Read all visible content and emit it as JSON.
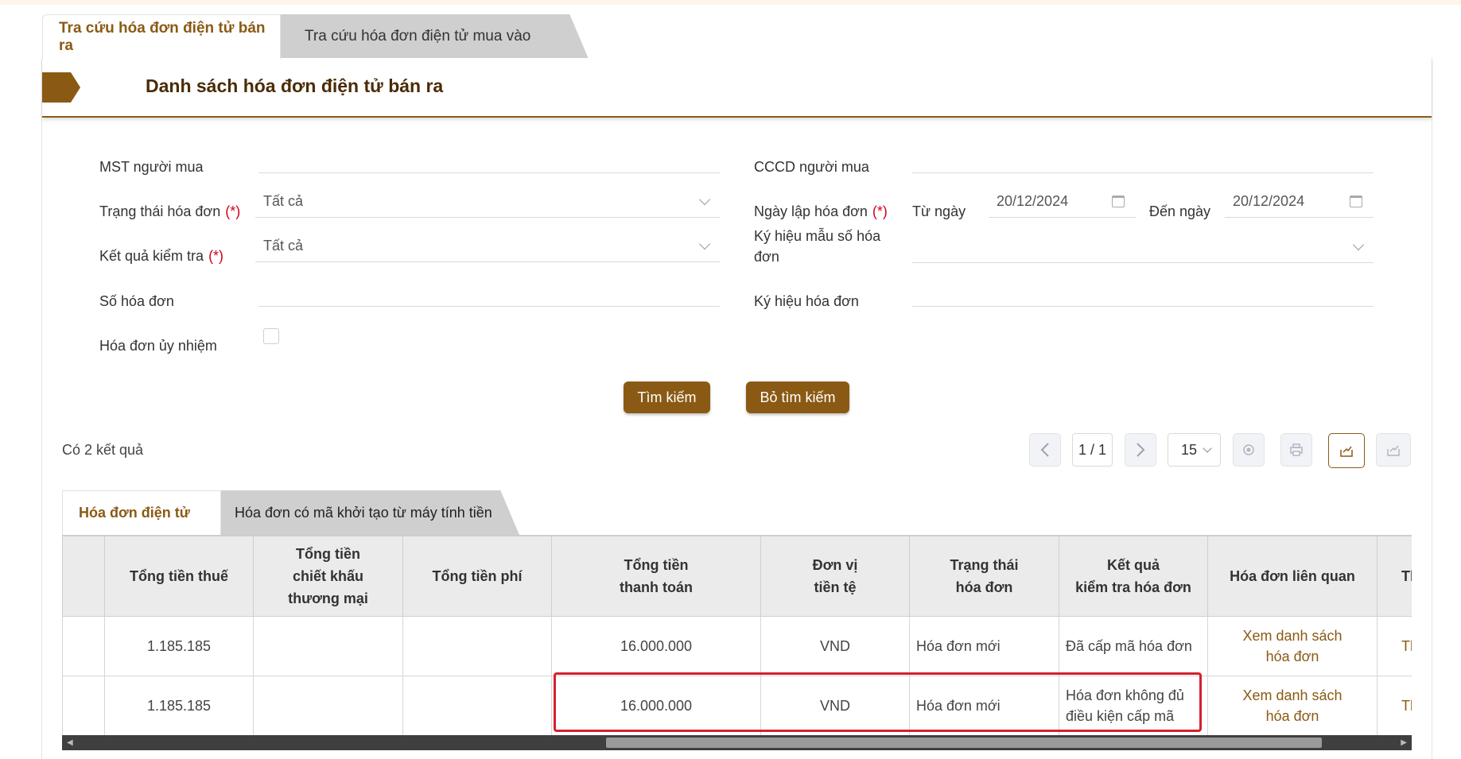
{
  "top_tabs": {
    "active": "Tra cứu hóa đơn điện tử bán ra",
    "inactive": "Tra cứu hóa đơn điện tử mua vào"
  },
  "panel": {
    "title": "Danh sách hóa đơn điện tử bán ra"
  },
  "form": {
    "mst_label": "MST người mua",
    "mst_value": "",
    "cccd_label": "CCCD người mua",
    "cccd_value": "",
    "status_label": "Trạng thái hóa đơn",
    "status_value": "Tất cả",
    "date_label": "Ngày lập hóa đơn",
    "from_label": "Từ ngày",
    "from_value": "20/12/2024",
    "to_label": "Đến ngày",
    "to_value": "20/12/2024",
    "check_label": "Kết quả kiểm tra",
    "check_value": "Tất cả",
    "template_label_1": "Ký hiệu mẫu số hóa",
    "template_label_2": "đơn",
    "template_value": "",
    "number_label": "Số hóa đơn",
    "number_value": "",
    "symbol_label": "Ký hiệu hóa đơn",
    "symbol_value": "",
    "delegated_label": "Hóa đơn ủy nhiệm",
    "required_mark": "(*)"
  },
  "buttons": {
    "search": "Tìm kiếm",
    "clear": "Bỏ tìm kiếm"
  },
  "results": {
    "count_text": "Có 2 kết quả",
    "page_text": "1 / 1",
    "page_size": "15",
    "prev_icon": "chevron-left-icon",
    "next_icon": "chevron-right-icon"
  },
  "inner_tabs": {
    "active": "Hóa đơn điện tử",
    "inactive": "Hóa đơn có mã khởi tạo từ máy tính tiền"
  },
  "table": {
    "headers": [
      {
        "l1": "",
        "l2": "",
        "l3": ""
      },
      {
        "l1": "Tổng tiền thuế",
        "l2": "",
        "l3": ""
      },
      {
        "l1": "Tổng tiền",
        "l2": "chiết khấu",
        "l3": "thương mại"
      },
      {
        "l1": "Tổng tiền phí",
        "l2": "",
        "l3": ""
      },
      {
        "l1": "Tổng tiền",
        "l2": "thanh toán",
        "l3": ""
      },
      {
        "l1": "Đơn vị",
        "l2": "tiền tệ",
        "l3": ""
      },
      {
        "l1": "Trạng thái",
        "l2": "hóa đơn",
        "l3": ""
      },
      {
        "l1": "Kết quả",
        "l2": "kiểm tra hóa đơn",
        "l3": ""
      },
      {
        "l1": "Hóa đơn liên quan",
        "l2": "",
        "l3": ""
      },
      {
        "l1": "Th",
        "l2": "",
        "l3": ""
      }
    ],
    "rows": [
      {
        "blank": "",
        "tax": "1.185.185",
        "discount": "",
        "fee": "",
        "total": "16.000.000",
        "currency": "VND",
        "status": "Hóa đơn mới",
        "check_l1": "Đã cấp mã hóa đơn",
        "check_l2": "",
        "related_l1": "Xem danh sách",
        "related_l2": "hóa đơn",
        "extra": "Th"
      },
      {
        "blank": "",
        "tax": "1.185.185",
        "discount": "",
        "fee": "",
        "total": "16.000.000",
        "currency": "VND",
        "status": "Hóa đơn mới",
        "check_l1": "Hóa đơn không đủ",
        "check_l2": "điều kiện cấp mã",
        "related_l1": "Xem danh sách",
        "related_l2": "hóa đơn",
        "extra": "Th"
      }
    ]
  },
  "colors": {
    "brand": "#8a5a14",
    "highlight": "#d6202d",
    "header_bg": "#ebebeb"
  }
}
